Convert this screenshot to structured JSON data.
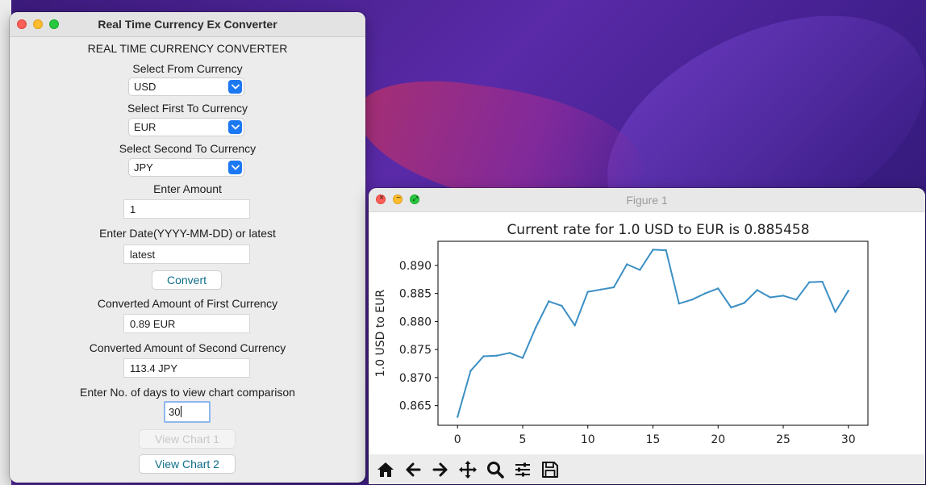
{
  "converter": {
    "window_title": "Real Time Currency Ex Converter",
    "heading": "REAL TIME CURRENCY CONVERTER",
    "from_label": "Select From Currency",
    "from_value": "USD",
    "first_to_label": "Select First To Currency",
    "first_to_value": "EUR",
    "second_to_label": "Select Second To Currency",
    "second_to_value": "JPY",
    "amount_label": "Enter Amount",
    "amount_value": "1",
    "date_label": "Enter Date(YYYY-MM-DD) or latest",
    "date_value": "latest",
    "convert_button": "Convert",
    "first_result_label": "Converted Amount of First Currency",
    "first_result_value": "0.89 EUR",
    "second_result_label": "Converted Amount of Second Currency",
    "second_result_value": "113.4 JPY",
    "days_label": "Enter No. of days to view chart comparison",
    "days_value": "30",
    "view_chart1_button": "View Chart 1",
    "view_chart2_button": "View Chart 2"
  },
  "figure": {
    "window_title": "Figure 1",
    "toolbar_icons": [
      "home-icon",
      "back-arrow-icon",
      "forward-arrow-icon",
      "pan-icon",
      "zoom-icon",
      "subplots-config-icon",
      "save-icon"
    ]
  },
  "chart_data": {
    "type": "line",
    "title": "Current rate for 1.0 USD to EUR is 0.885458",
    "xlabel": "",
    "ylabel": "1.0 USD to EUR",
    "xlim": [
      -1.5,
      31.5
    ],
    "ylim": [
      0.8615,
      0.8943
    ],
    "xticks": [
      0,
      5,
      10,
      15,
      20,
      25,
      30
    ],
    "yticks": [
      0.865,
      0.87,
      0.875,
      0.88,
      0.885,
      0.89
    ],
    "ytick_labels": [
      "0.865",
      "0.870",
      "0.875",
      "0.880",
      "0.885",
      "0.890"
    ],
    "line_color": "#3b8fc4",
    "series": [
      {
        "x": [
          0,
          1,
          2,
          3,
          4,
          5,
          6,
          7,
          8,
          9,
          10,
          11,
          12,
          13,
          14,
          15,
          16,
          17,
          18,
          19,
          20,
          21,
          22,
          23,
          24,
          25,
          26,
          27,
          28,
          29,
          30
        ],
        "values": [
          0.863,
          0.8712,
          0.8738,
          0.8739,
          0.8744,
          0.8735,
          0.8789,
          0.8836,
          0.8828,
          0.8793,
          0.8853,
          0.8857,
          0.8861,
          0.8902,
          0.8892,
          0.8928,
          0.8927,
          0.8832,
          0.8839,
          0.885,
          0.8859,
          0.8825,
          0.8833,
          0.8856,
          0.8843,
          0.8846,
          0.8839,
          0.887,
          0.8871,
          0.8817,
          0.8855
        ]
      }
    ]
  }
}
